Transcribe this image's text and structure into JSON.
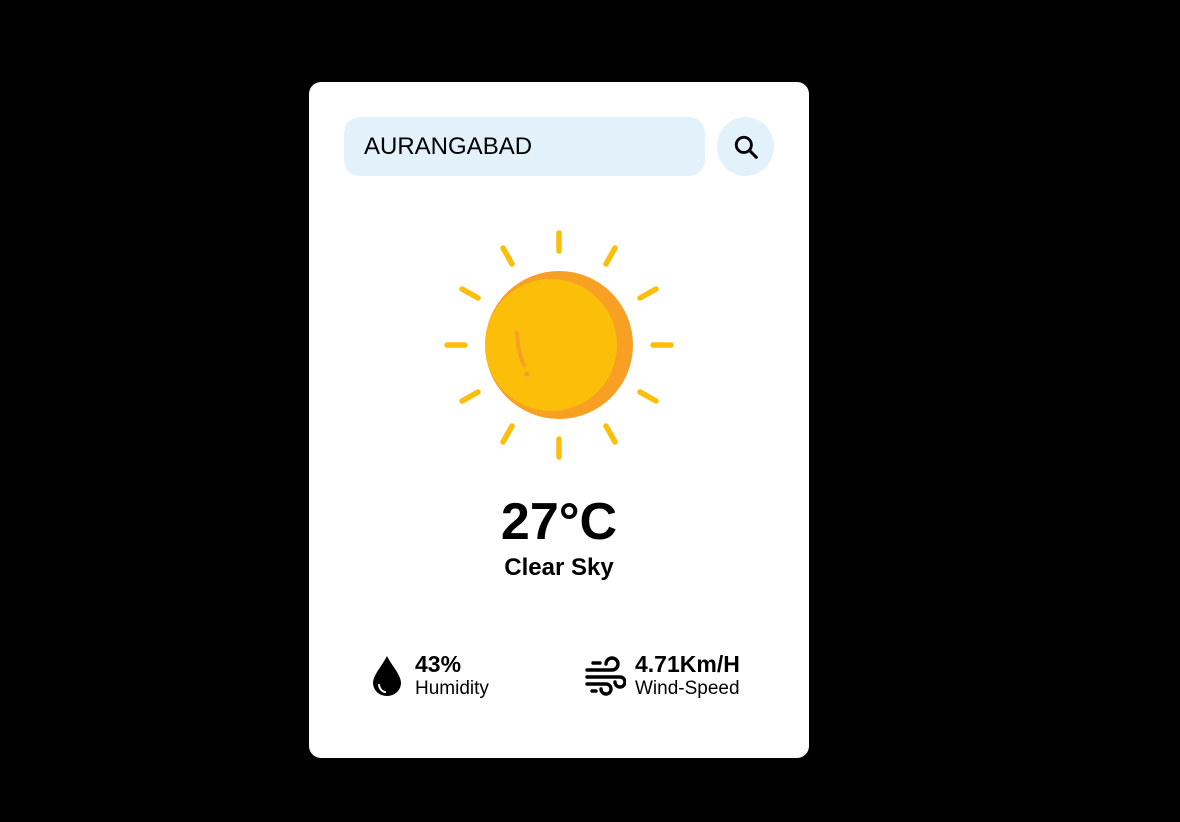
{
  "search": {
    "value": "AURANGABAD",
    "icon": "search-icon"
  },
  "weather": {
    "icon": "clear-sky-sun-icon",
    "temperature": "27°C",
    "condition": "Clear Sky"
  },
  "humidity": {
    "icon": "water-drop-icon",
    "value": "43%",
    "label": "Humidity"
  },
  "wind": {
    "icon": "wind-icon",
    "value": "4.71Km/H",
    "label": "Wind-Speed"
  },
  "colors": {
    "page_background": "#000000",
    "card_background": "#ffffff",
    "input_background": "#e3f2fa",
    "sun_primary": "#fbbf0a",
    "sun_shadow": "#f7a024"
  }
}
